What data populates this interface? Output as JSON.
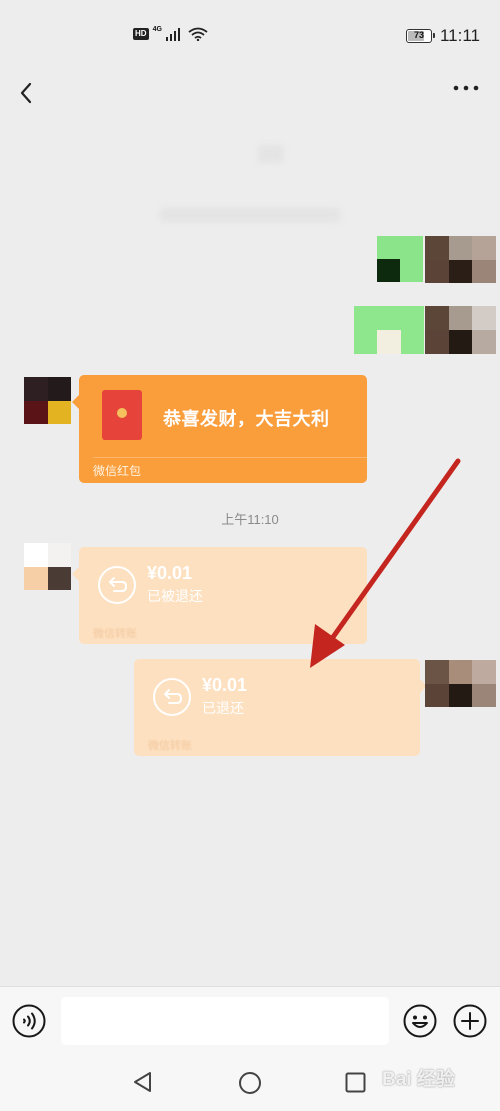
{
  "status_bar": {
    "hd_badge": "HD",
    "network_type": "4G",
    "battery_percent": "73",
    "battery_level": 0.73,
    "time": "11:11",
    "icons": [
      "signal-bars-icon",
      "wifi-icon",
      "battery-icon"
    ]
  },
  "header": {
    "title": "",
    "back_icon": "chevron-left-icon",
    "more_icon": "more-dots-icon"
  },
  "messages": {
    "red_packet": {
      "greeting": "恭喜发财，大吉大利",
      "footer": "微信红包",
      "color": "#fa9d3b"
    },
    "timestamp": "上午11:10",
    "transfer_received": {
      "amount": "¥0.01",
      "status": "已被退还",
      "footer": "微信转账",
      "color": "#fde0c0"
    },
    "transfer_sent": {
      "amount": "¥0.01",
      "status": "已退还",
      "footer": "微信转账",
      "color": "#fde0c0"
    }
  },
  "annotation": {
    "arrow_color": "#c4251f"
  },
  "input_bar": {
    "message_value": "",
    "voice_icon": "voice-icon",
    "emoji_icon": "emoji-icon",
    "plus_icon": "plus-icon"
  },
  "system_nav": {
    "icons": [
      "nav-back-icon",
      "nav-home-icon",
      "nav-recent-icon"
    ]
  },
  "watermark": {
    "text": "Bai 经验"
  }
}
